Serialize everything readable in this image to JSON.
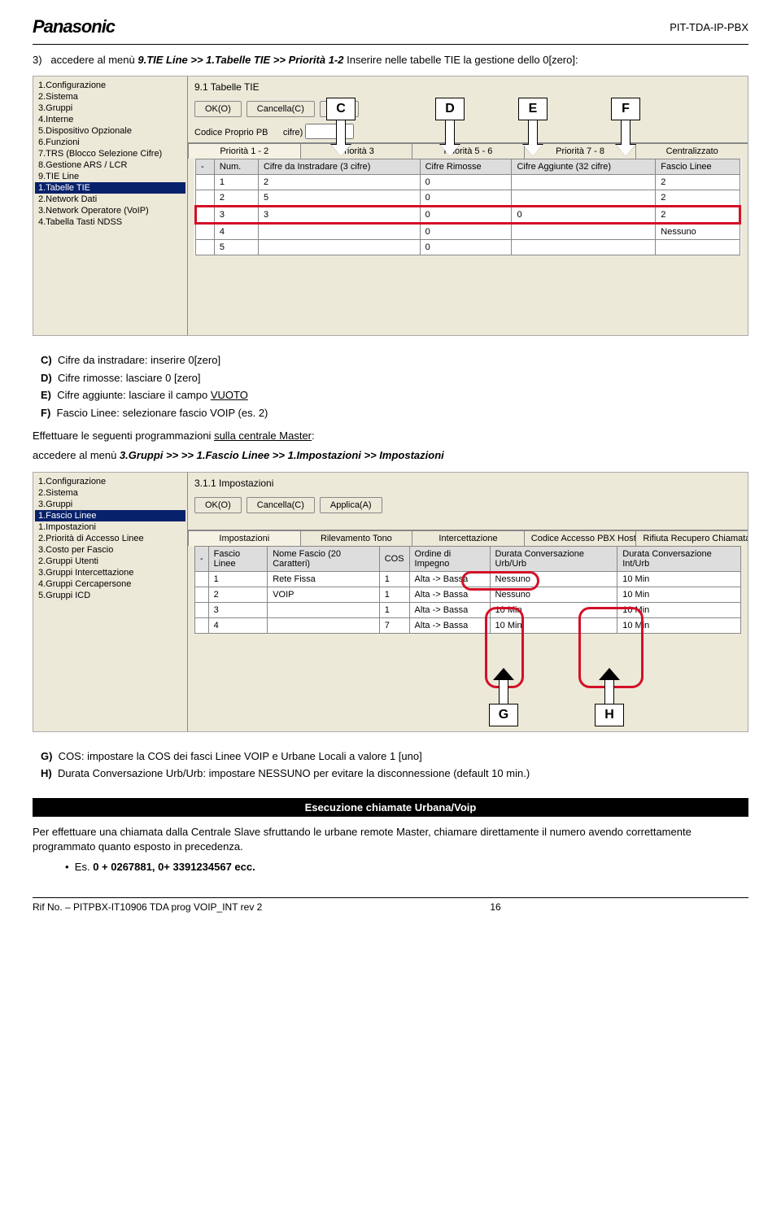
{
  "header": {
    "logo": "Panasonic",
    "pitcode": "PIT-TDA-IP-PBX"
  },
  "intro": {
    "num": "3)",
    "text1": "accedere al menù ",
    "path": "9.TIE Line >> 1.Tabelle TIE >> Priorità 1-2",
    "text2": " Inserire nelle tabelle TIE la gestione dello 0[zero]:"
  },
  "shot1": {
    "title": "9.1 Tabelle TIE",
    "buttons": [
      "OK(O)",
      "Cancella(C)",
      "Appl"
    ],
    "field_label": "Codice Proprio PB",
    "field2": "cifre)",
    "tabs": [
      "Priorità 1 - 2",
      "Priorità 3",
      "Priorità 5 - 6",
      "Priorità 7 - 8",
      "Centralizzato"
    ],
    "headers": [
      "-",
      "Num.",
      "Cifre da Instradare (3 cifre)",
      "Cifre Rimosse",
      "Cifre Aggiunte (32 cifre)",
      "Fascio Linee"
    ],
    "rows": [
      [
        "",
        "1",
        "2",
        "0",
        "",
        "2"
      ],
      [
        "",
        "2",
        "5",
        "0",
        "",
        "2"
      ],
      [
        "",
        "3",
        "3",
        "0",
        "0",
        "2"
      ],
      [
        "",
        "4",
        "",
        "0",
        "",
        "Nessuno"
      ],
      [
        "",
        "5",
        "",
        "0",
        "",
        ""
      ]
    ],
    "hl_row_index": 2,
    "tree": [
      "1.Configurazione",
      "2.Sistema",
      "3.Gruppi",
      "4.Interne",
      "5.Dispositivo Opzionale",
      "6.Funzioni",
      "7.TRS (Blocco Selezione Cifre)",
      "8.Gestione ARS / LCR",
      "9.TIE Line",
      "  1.Tabelle TIE",
      "  2.Network Dati",
      "  3.Network Operatore (VoIP)",
      "  4.Tabella Tasti NDSS"
    ],
    "tree_sel": 9
  },
  "callouts1": [
    "C",
    "D",
    "E",
    "F"
  ],
  "list1": [
    {
      "k": "C)",
      "t": "Cifre da instradare: inserire 0[zero]"
    },
    {
      "k": "D)",
      "t": "Cifre rimosse: lasciare 0 [zero]"
    },
    {
      "k": "E)",
      "t": "Cifre aggiunte: lasciare il campo ",
      "u": "VUOTO"
    },
    {
      "k": "F)",
      "t": "Fascio Linee: selezionare fascio VOIP (es. 2)"
    }
  ],
  "mid1": {
    "t1": "Effettuare le seguenti programmazioni ",
    "u1": "sulla centrale Master",
    "t2": ":",
    "t3": "accedere al menù ",
    "path": "3.Gruppi >> >> 1.Fascio Linee >> 1.Impostazioni >> Impostazioni"
  },
  "shot2": {
    "title": "3.1.1 Impostazioni",
    "buttons": [
      "OK(O)",
      "Cancella(C)",
      "Applica(A)"
    ],
    "tabs": [
      "Impostazioni",
      "Rilevamento Tono",
      "Intercettazione",
      "Codice Accesso PBX Host",
      "Rifiuta Recupero Chiamata (per il Brasi"
    ],
    "headers": [
      "-",
      "Fascio Linee",
      "Nome Fascio (20 Caratteri)",
      "COS",
      "Ordine di Impegno",
      "Durata Conversazione Urb/Urb",
      "Durata Conversazione Int/Urb"
    ],
    "rows": [
      [
        "",
        "1",
        "Rete Fissa",
        "1",
        "Alta -> Bassa",
        "Nessuno",
        "10 Min"
      ],
      [
        "",
        "2",
        "VOIP",
        "1",
        "Alta -> Bassa",
        "Nessuno",
        "10 Min"
      ],
      [
        "",
        "3",
        "",
        "1",
        "Alta -> Bassa",
        "10 Min",
        "10 Min"
      ],
      [
        "",
        "4",
        "",
        "7",
        "Alta -> Bassa",
        "10 Min",
        "10 Min"
      ]
    ],
    "tree": [
      "1.Configurazione",
      "2.Sistema",
      "3.Gruppi",
      "  1.Fascio Linee",
      "    1.Impostazioni",
      "    2.Priorità di Accesso Linee",
      "    3.Costo per Fascio",
      "  2.Gruppi Utenti",
      "  3.Gruppi Intercettazione",
      "  4.Gruppi Cercapersone",
      "  5.Gruppi ICD"
    ],
    "tree_sel": 3
  },
  "callouts2": [
    "G",
    "H"
  ],
  "list2": [
    {
      "k": "G)",
      "t": "COS: impostare la COS dei fasci Linee VOIP e Urbane Locali a valore 1 [uno]"
    },
    {
      "k": "H)",
      "t": "Durata Conversazione Urb/Urb: impostare NESSUNO per evitare la disconnessione (default 10 min.)"
    }
  ],
  "blackbar": "Esecuzione chiamate Urbana/Voip",
  "after_black": "Per effettuare una chiamata dalla Centrale Slave sfruttando le urbane remote Master, chiamare direttamente il numero avendo correttamente programmato quanto esposto in precedenza.",
  "bullet": {
    "pre": "Es. ",
    "b": "0 + 0267881, 0+ 3391234567 ecc."
  },
  "footer": {
    "t": "Rif No. – PITPBX-IT10906 TDA prog VOIP_INT rev 2",
    "pg": "16"
  }
}
